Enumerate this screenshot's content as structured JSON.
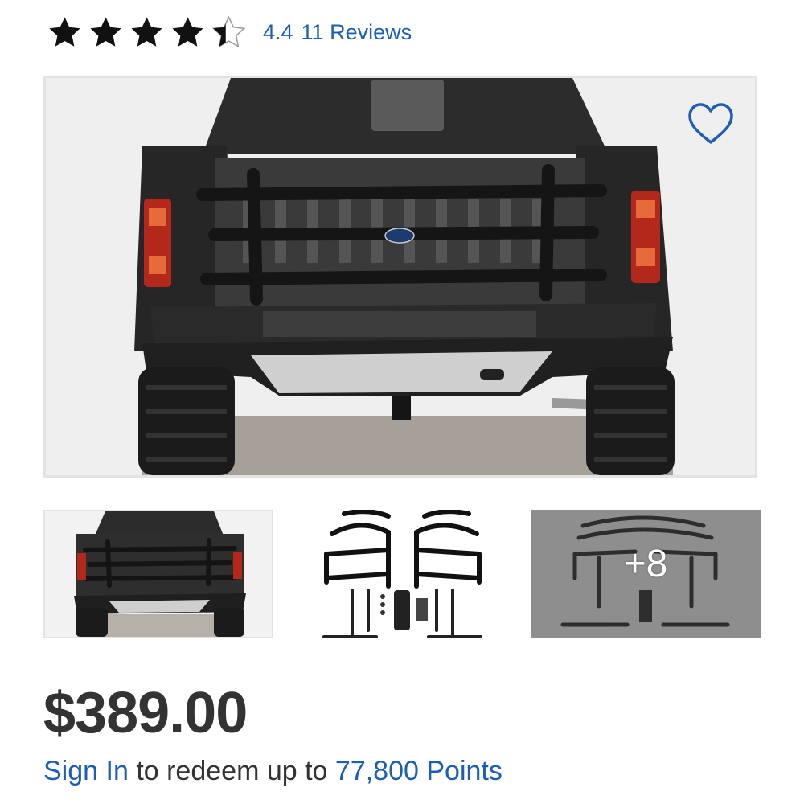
{
  "rating": {
    "value": "4.4",
    "reviews_label": "11 Reviews",
    "stars": [
      {
        "state": "full",
        "icon": "star-filled-icon"
      },
      {
        "state": "full",
        "icon": "star-filled-icon"
      },
      {
        "state": "full",
        "icon": "star-filled-icon"
      },
      {
        "state": "full",
        "icon": "star-filled-icon"
      },
      {
        "state": "partial",
        "fraction": 0.4,
        "icon": "star-partial-icon"
      }
    ]
  },
  "gallery": {
    "favorite_icon": "heart-outline-icon",
    "thumbnails": [
      {
        "icon": "truck-rear-thumbnail"
      },
      {
        "icon": "parts-layout-thumbnail"
      },
      {
        "icon": "parts-more-thumbnail",
        "overlay": "+8"
      }
    ]
  },
  "price": {
    "amount": "$389.00"
  },
  "rewards": {
    "sign_in_label": "Sign In",
    "middle_text": "to redeem up to",
    "points_label": "77,800 Points"
  },
  "colors": {
    "link": "#1a5fb4",
    "text": "#333333",
    "star": "#111111"
  }
}
